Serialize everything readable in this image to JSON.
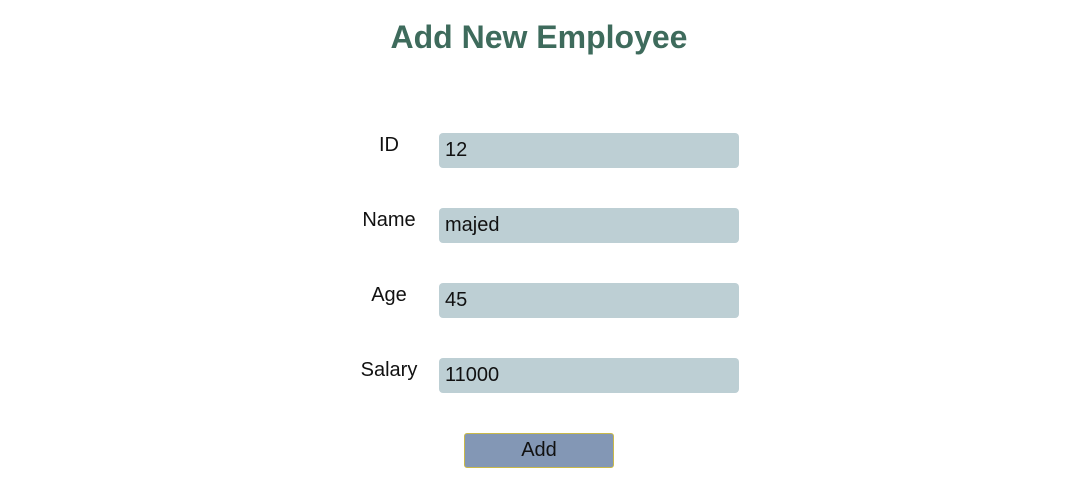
{
  "title": "Add New Employee",
  "form": {
    "id": {
      "label": "ID",
      "value": "12"
    },
    "name": {
      "label": "Name",
      "value": "majed"
    },
    "age": {
      "label": "Age",
      "value": "45"
    },
    "salary": {
      "label": "Salary",
      "value": "11000"
    },
    "submit_label": "Add"
  },
  "colors": {
    "title": "#3e6b5c",
    "input_background": "#bdcfd4",
    "button_background": "#8397b5",
    "button_border": "#c9b94a"
  }
}
